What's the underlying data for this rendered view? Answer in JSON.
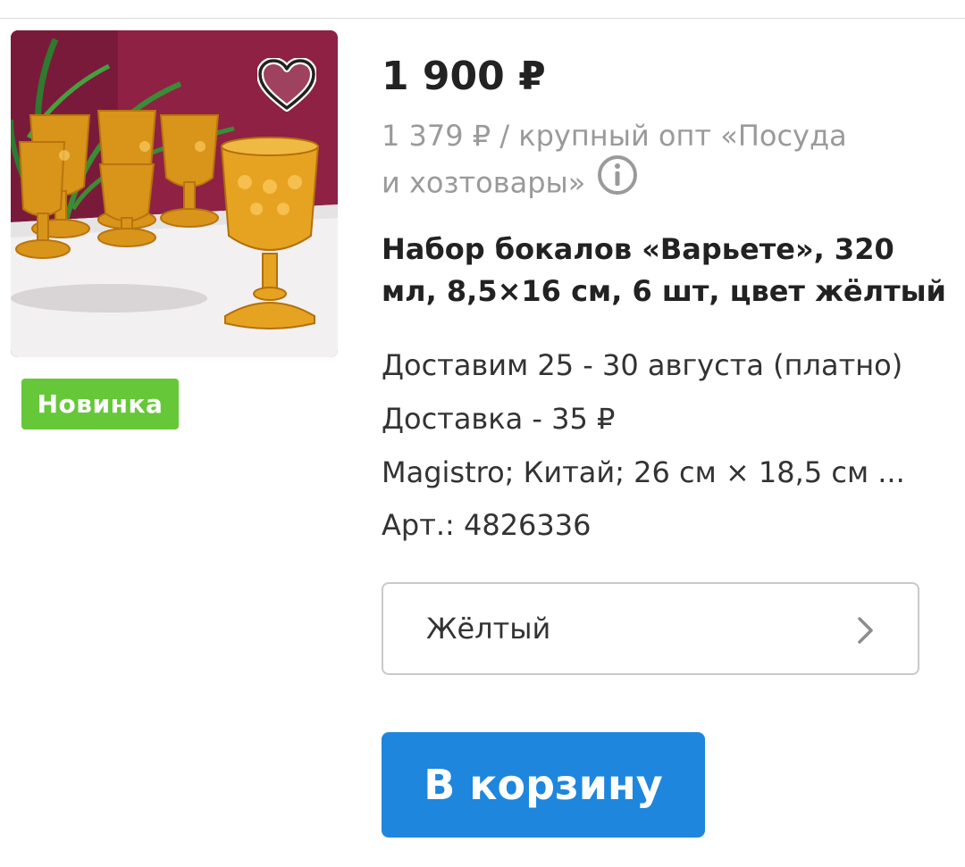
{
  "product": {
    "price": "1 900 ₽",
    "wholesale_line1": "1 379 ₽ / крупный опт «Посуда",
    "wholesale_line2": "и хозтовары»",
    "title_line1": "Набор бокалов «Варьете», 320",
    "title_line2": "мл, 8,5×16 см, 6 шт, цвет жёлтый",
    "delivery_date": "Доставим 25 - 30 августа (платно)",
    "delivery_cost": "Доставка - 35 ₽",
    "brand_info": "Magistro; Китай; 26 см × 18,5 см ...",
    "sku": "Арт.: 4826336",
    "badge": "Новинка"
  },
  "variant": {
    "selected": "Жёлтый"
  },
  "actions": {
    "add_to_cart": "В корзину"
  },
  "colors": {
    "price_text": "#222222",
    "muted_text": "#9a9a9a",
    "badge_green": "#66c738",
    "button_blue": "#1e86dd",
    "glass_amber": "#e0a020"
  },
  "icons": {
    "favorite": "heart-icon",
    "info": "info-icon",
    "select_arrow": "chevron-right-icon"
  }
}
